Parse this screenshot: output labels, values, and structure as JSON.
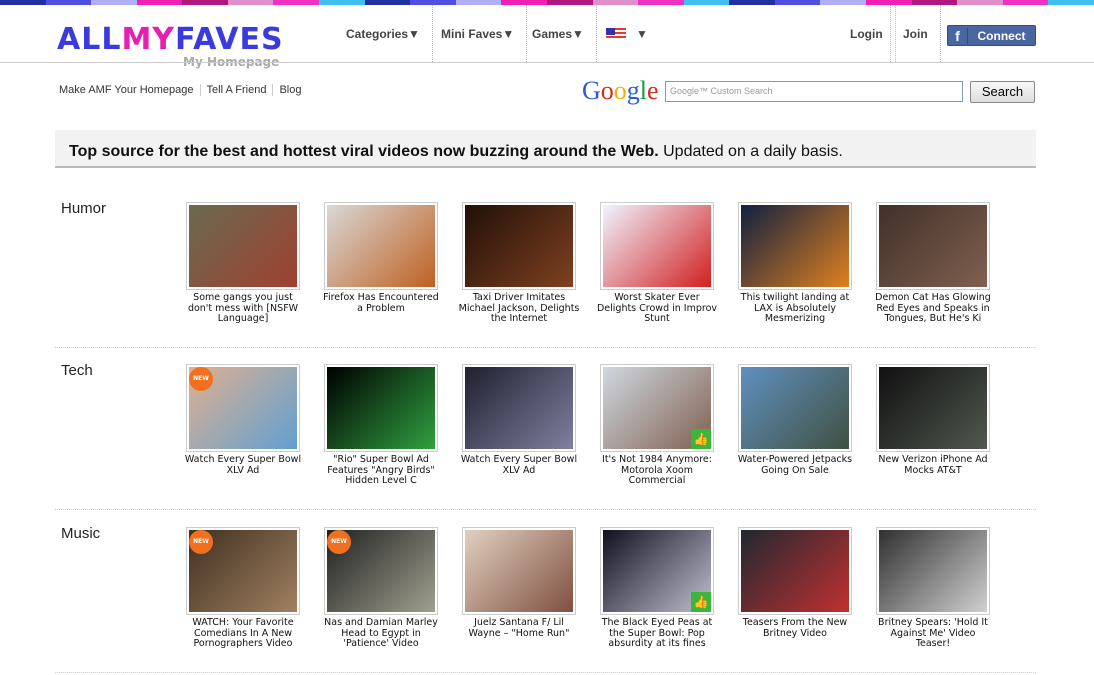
{
  "header": {
    "logo": {
      "all": "ALL",
      "my": "MY",
      "faves": "FAVES",
      "tagline": "My Homepage"
    },
    "nav": [
      {
        "label": "Categories▼"
      },
      {
        "label": "Mini Faves▼"
      },
      {
        "label": "Games▼"
      },
      {
        "label": "▼"
      }
    ],
    "login": "Login",
    "join": "Join",
    "connect": "Connect",
    "fb_icon": "f",
    "stripe_colors": [
      "#2030a0",
      "#5050e0",
      "#b0b0f8",
      "#f020b0",
      "#b01880",
      "#e090c8",
      "#f030c0",
      "#40c0f0"
    ]
  },
  "subnav": {
    "links": [
      "Make AMF Your Homepage",
      "Tell A Friend",
      "Blog"
    ],
    "google": "Google",
    "search_placeholder": "Google™ Custom Search",
    "search_button": "Search"
  },
  "banner": {
    "bold": "Top source for the best and hottest viral videos now buzzing around the Web.",
    "rest": " Updated on a daily basis."
  },
  "badges": {
    "new": "NEW",
    "like": "👍"
  },
  "sections": [
    {
      "category": "Humor",
      "items": [
        {
          "caption": "Some gangs you just don't mess with [NSFW Language]",
          "c1": "#6a6a50",
          "c2": "#a04030"
        },
        {
          "caption": "Firefox Has Encountered a Problem",
          "c1": "#d8d8d8",
          "c2": "#c06020"
        },
        {
          "caption": "Taxi Driver Imitates Michael Jackson, Delights the Internet",
          "c1": "#201008",
          "c2": "#804020"
        },
        {
          "caption": "Worst Skater Ever Delights Crowd in Improv Stunt",
          "c1": "#f0f4ff",
          "c2": "#d02020"
        },
        {
          "caption": "This twilight landing at LAX is Absolutely Mesmerizing",
          "c1": "#102040",
          "c2": "#e08020"
        },
        {
          "caption": "Demon Cat Has Glowing Red Eyes and Speaks in Tongues, But He's Ki",
          "c1": "#403028",
          "c2": "#806050"
        }
      ]
    },
    {
      "category": "Tech",
      "items": [
        {
          "caption": "Watch Every Super Bowl XLV Ad",
          "c1": "#e0b090",
          "c2": "#60a0d0",
          "new": true
        },
        {
          "caption": "\"Rio\" Super Bowl Ad Features \"Angry Birds\" Hidden Level C",
          "c1": "#000",
          "c2": "#30a040"
        },
        {
          "caption": "Watch Every Super Bowl XLV Ad",
          "c1": "#202030",
          "c2": "#8080a0"
        },
        {
          "caption": "It's Not 1984 Anymore: Motorola Xoom Commercial",
          "c1": "#d0d8e0",
          "c2": "#806050",
          "like": true
        },
        {
          "caption": "Water-Powered Jetpacks Going On Sale",
          "c1": "#6090c0",
          "c2": "#405040"
        },
        {
          "caption": "New Verizon iPhone Ad Mocks AT&T",
          "c1": "#101010",
          "c2": "#505850"
        }
      ]
    },
    {
      "category": "Music",
      "items": [
        {
          "caption": "WATCH: Your Favorite Comedians In A New Pornographers Video",
          "c1": "#403020",
          "c2": "#a08060",
          "new": true
        },
        {
          "caption": "Nas and Damian Marley Head to Egypt in 'Patience' Video",
          "c1": "#202020",
          "c2": "#a0a090",
          "new": true
        },
        {
          "caption": "Juelz Santana F/ Lil Wayne – \"Home Run\"",
          "c1": "#e0d0c0",
          "c2": "#805040"
        },
        {
          "caption": "The Black Eyed Peas at the Super Bowl: Pop absurdity at its fines",
          "c1": "#101020",
          "c2": "#c0c0d0",
          "like": true
        },
        {
          "caption": "Teasers From the New Britney Video",
          "c1": "#202830",
          "c2": "#c03030"
        },
        {
          "caption": "Britney Spears: 'Hold It Against Me' Video Teaser!",
          "c1": "#303030",
          "c2": "#d0d0d0"
        }
      ]
    }
  ]
}
